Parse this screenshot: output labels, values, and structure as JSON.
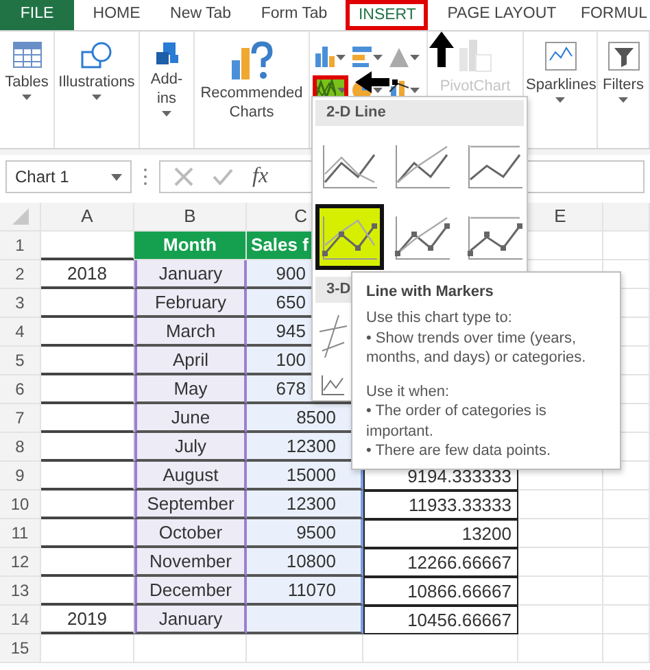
{
  "tabs": [
    {
      "label": "FILE",
      "kind": "file",
      "selected": false,
      "annotated": false
    },
    {
      "label": "HOME",
      "kind": "tab",
      "selected": false,
      "annotated": false
    },
    {
      "label": "New Tab",
      "kind": "tab",
      "selected": false,
      "annotated": false
    },
    {
      "label": "Form Tab",
      "kind": "tab",
      "selected": false,
      "annotated": false
    },
    {
      "label": "INSERT",
      "kind": "tab",
      "selected": true,
      "annotated": true
    },
    {
      "label": "PAGE LAYOUT",
      "kind": "tab",
      "selected": false,
      "annotated": false
    },
    {
      "label": "FORMUL",
      "kind": "tab",
      "selected": false,
      "annotated": false
    }
  ],
  "ribbon_groups": [
    {
      "label": "Tables",
      "kind": "table"
    },
    {
      "label": "Illustrations",
      "kind": "shapes"
    },
    {
      "label": "Add-ins",
      "kind": "addin"
    },
    {
      "label": "Recommended Charts",
      "kind": "recommended"
    },
    {
      "kind": "charts"
    },
    {
      "label": "PivotChart",
      "kind": "pivot",
      "disabled": true
    },
    {
      "label": "Sparklines",
      "kind": "sparkline"
    },
    {
      "label": "Filters",
      "kind": "filter"
    }
  ],
  "chart_buttons": [
    {
      "kind": "column",
      "annotated": false
    },
    {
      "kind": "bar",
      "annotated": false
    },
    {
      "kind": "hierarchy",
      "annotated": false
    },
    {
      "kind": "line",
      "annotated": true
    },
    {
      "kind": "pie",
      "annotated": false
    },
    {
      "kind": "combo",
      "annotated": false
    }
  ],
  "formula_bar": {
    "name_box": "Chart 1",
    "function_label": "fx"
  },
  "chart_menu": {
    "sections": [
      {
        "title": "2-D Line",
        "items": [
          {
            "kind": "line",
            "selected": false
          },
          {
            "kind": "stacked-line",
            "selected": false
          },
          {
            "kind": "full-stacked-line",
            "selected": false
          },
          {
            "kind": "line-markers",
            "selected": true
          },
          {
            "kind": "stacked-markers",
            "selected": false
          },
          {
            "kind": "full-stacked-markers",
            "selected": false
          }
        ]
      },
      {
        "title": "3-D",
        "items": [
          {
            "kind": "line-3d",
            "selected": false
          }
        ]
      }
    ]
  },
  "tooltip": {
    "title": "Line with Markers",
    "paragraphs": [
      [
        "Use this chart type to:",
        "• Show trends over time (years, months, and days) or categories."
      ],
      [
        "Use it when:",
        "• The order of categories is important.",
        "• There are few data points."
      ]
    ]
  },
  "sheet": {
    "columns": [
      "A",
      "B",
      "C",
      null,
      "E"
    ],
    "rows": [
      {
        "number": "1",
        "cells": [
          null,
          "Month",
          "Sales f",
          null
        ]
      },
      {
        "number": "2",
        "cells": [
          "2018",
          "January",
          "900",
          null
        ]
      },
      {
        "number": "3",
        "cells": [
          null,
          "February",
          "650",
          null
        ]
      },
      {
        "number": "4",
        "cells": [
          null,
          "March",
          "945",
          null
        ]
      },
      {
        "number": "5",
        "cells": [
          null,
          "April",
          "100",
          null
        ]
      },
      {
        "number": "6",
        "cells": [
          null,
          "May",
          "678",
          null
        ]
      },
      {
        "number": "7",
        "cells": [
          null,
          "June",
          "8500",
          null
        ]
      },
      {
        "number": "8",
        "cells": [
          null,
          "July",
          "12300",
          null
        ]
      },
      {
        "number": "9",
        "cells": [
          null,
          "August",
          "15000",
          "9194.333333"
        ]
      },
      {
        "number": "10",
        "cells": [
          null,
          "September",
          "12300",
          "11933.33333"
        ]
      },
      {
        "number": "11",
        "cells": [
          null,
          "October",
          "9500",
          "13200"
        ]
      },
      {
        "number": "12",
        "cells": [
          null,
          "November",
          "10800",
          "12266.66667"
        ]
      },
      {
        "number": "13",
        "cells": [
          null,
          "December",
          "11070",
          "10866.66667"
        ]
      },
      {
        "number": "14",
        "cells": [
          "2019",
          "January",
          null,
          "10456.66667"
        ]
      },
      {
        "number": "15",
        "cells": [
          null,
          null,
          null,
          null
        ]
      }
    ]
  }
}
